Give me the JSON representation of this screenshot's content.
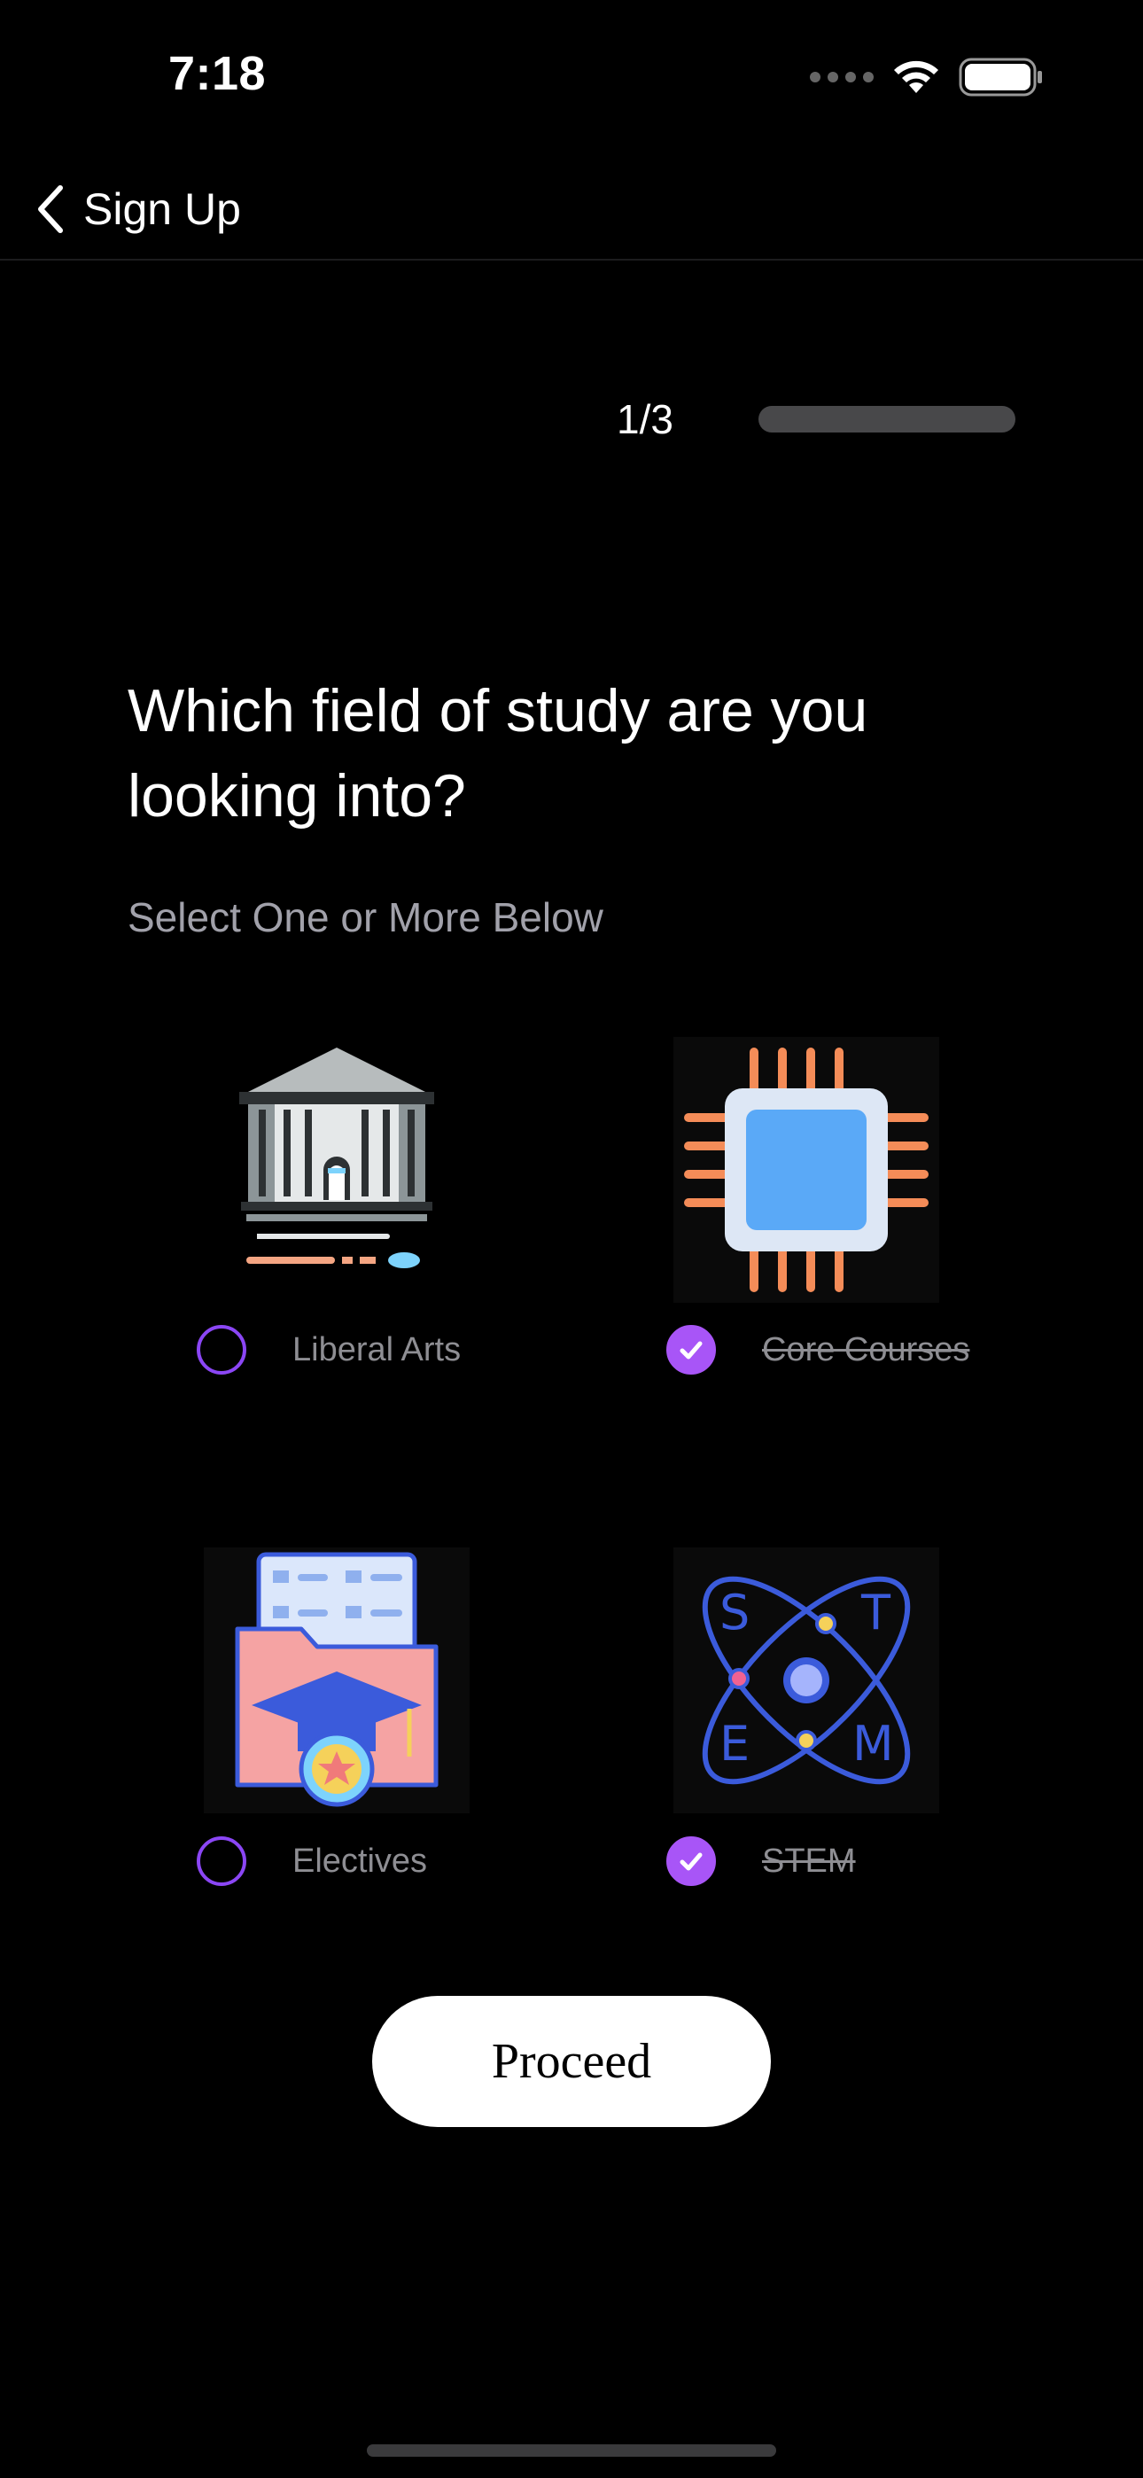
{
  "status_bar": {
    "time": "7:18"
  },
  "nav": {
    "back_label": "Sign Up"
  },
  "progress": {
    "step_text": "1/3",
    "fraction": 0
  },
  "heading": "Which field of study are you looking into?",
  "subheading": "Select One or More Below",
  "options": [
    {
      "label": "Liberal Arts",
      "icon": "building-icon",
      "selected": false
    },
    {
      "label": "Core Courses",
      "icon": "cpu-chip-icon",
      "selected": true
    },
    {
      "label": "Electives",
      "icon": "folder-graduation-icon",
      "selected": false
    },
    {
      "label": "STEM",
      "icon": "stem-atom-icon",
      "selected": true
    }
  ],
  "proceed_label": "Proceed",
  "colors": {
    "accent": "#a855f7",
    "background": "#000000"
  }
}
